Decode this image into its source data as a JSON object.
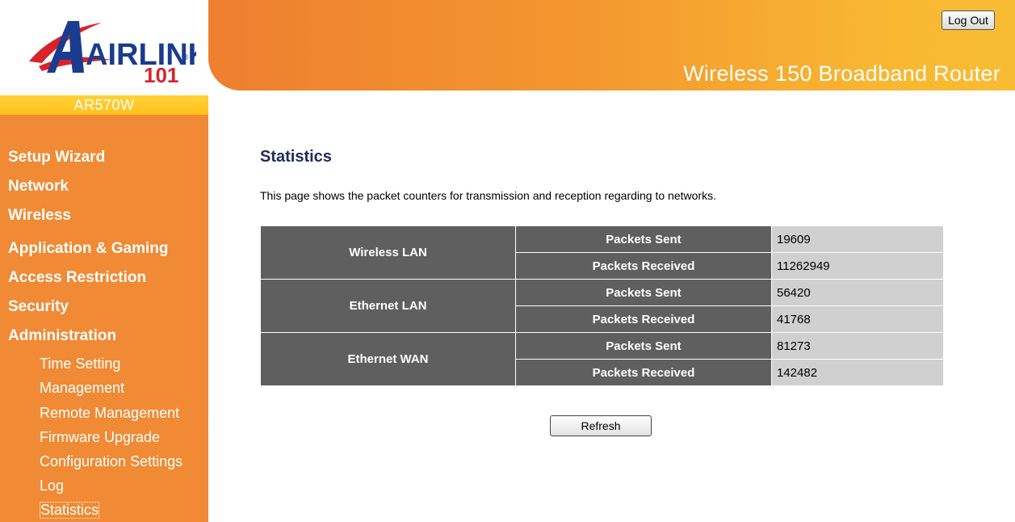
{
  "brand": {
    "logo_text": "AIRLINK",
    "logo_number": "101",
    "registered_mark": "®",
    "model": "AR570W",
    "colors": {
      "orange": "#f08a34",
      "yellow": "#ffc21a",
      "red": "#d8232a",
      "blue": "#1a3c8e"
    }
  },
  "header": {
    "title": "Wireless 150 Broadband Router",
    "logout_label": "Log Out"
  },
  "sidebar": {
    "main_items": [
      {
        "label": "Setup Wizard"
      },
      {
        "label": "Network"
      },
      {
        "label": "Wireless"
      },
      {
        "label": "Application & Gaming"
      },
      {
        "label": "Access Restriction"
      },
      {
        "label": "Security"
      },
      {
        "label": "Administration"
      }
    ],
    "sub_items": [
      {
        "label": "Time Setting"
      },
      {
        "label": "Management"
      },
      {
        "label": "Remote Management"
      },
      {
        "label": "Firmware Upgrade"
      },
      {
        "label": "Configuration Settings"
      },
      {
        "label": "Log"
      },
      {
        "label": "Statistics",
        "active": true
      }
    ]
  },
  "main": {
    "title": "Statistics",
    "description": "This page shows the packet counters for transmission and reception regarding to networks.",
    "stats": [
      {
        "network": "Wireless LAN",
        "sent_label": "Packets Sent",
        "sent": "19609",
        "received_label": "Packets Received",
        "received": "11262949"
      },
      {
        "network": "Ethernet LAN",
        "sent_label": "Packets Sent",
        "sent": "56420",
        "received_label": "Packets Received",
        "received": "41768"
      },
      {
        "network": "Ethernet WAN",
        "sent_label": "Packets Sent",
        "sent": "81273",
        "received_label": "Packets Received",
        "received": "142482"
      }
    ],
    "refresh_label": "Refresh"
  }
}
